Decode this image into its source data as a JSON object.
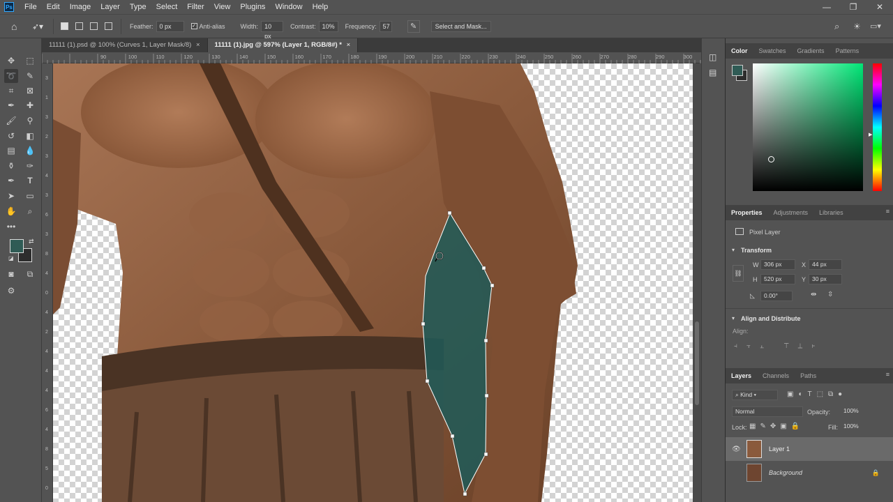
{
  "app": {
    "logo": "Ps"
  },
  "menu": [
    "File",
    "Edit",
    "Image",
    "Layer",
    "Type",
    "Select",
    "Filter",
    "View",
    "Plugins",
    "Window",
    "Help"
  ],
  "window_controls": {
    "minimize": "—",
    "restore": "❐",
    "close": "✕"
  },
  "options": {
    "feather_label": "Feather:",
    "feather_value": "0 px",
    "antialias_label": "Anti-alias",
    "width_label": "Width:",
    "width_value": "10 px",
    "contrast_label": "Contrast:",
    "contrast_value": "10%",
    "frequency_label": "Frequency:",
    "frequency_value": "57",
    "select_mask": "Select and Mask..."
  },
  "tabs": [
    {
      "label": "11111 (1).psd @ 100% (Curves 1, Layer Mask/8)",
      "close": "×"
    },
    {
      "label": "11111 (1).jpg @ 597% (Layer 1, RGB/8#) *",
      "close": "×"
    }
  ],
  "ruler_top_labels": [
    "90",
    "100",
    "110",
    "120",
    "130",
    "140",
    "150",
    "160",
    "170",
    "180",
    "190",
    "200",
    "210",
    "220",
    "230",
    "240",
    "250",
    "260",
    "270",
    "280",
    "290",
    "300"
  ],
  "ruler_left_labels": [
    "3",
    "1",
    "3",
    "2",
    "3",
    "4",
    "3",
    "6",
    "3",
    "8",
    "4",
    "0",
    "4",
    "2",
    "4",
    "4",
    "4",
    "6",
    "4",
    "8",
    "5",
    "0"
  ],
  "panels": {
    "color_tabs": [
      "Color",
      "Swatches",
      "Gradients",
      "Patterns"
    ],
    "color": {
      "fg": "#2f5b55",
      "bg": "#2d2d2d",
      "picker_hue": "#00e676"
    },
    "properties_tabs": [
      "Properties",
      "Adjustments",
      "Libraries"
    ],
    "pixel_layer": "Pixel Layer",
    "transform_title": "Transform",
    "w_label": "W",
    "w_value": "306 px",
    "x_label": "X",
    "x_value": "44 px",
    "h_label": "H",
    "h_value": "520 px",
    "y_label": "Y",
    "y_value": "30 px",
    "angle_value": "0.00°",
    "align_title": "Align and Distribute",
    "align_label": "Align:",
    "layers_tabs": [
      "Layers",
      "Channels",
      "Paths"
    ],
    "kind_label": "Kind",
    "blend_mode": "Normal",
    "opacity_label": "Opacity:",
    "opacity_value": "100%",
    "lock_label": "Lock:",
    "fill_label": "Fill:",
    "fill_value": "100%",
    "layers": [
      {
        "name": "Layer 1",
        "visible": true,
        "selected": true
      },
      {
        "name": "Background",
        "visible": false,
        "selected": false
      }
    ]
  }
}
